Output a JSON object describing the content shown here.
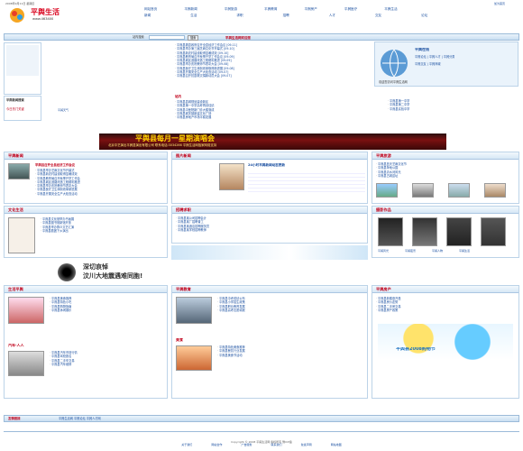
{
  "top": {
    "date": "2008年9月11日 星期四",
    "right_link": "加为首页"
  },
  "logo": {
    "main": "平舆生活",
    "sub": "www.463400"
  },
  "nav": [
    [
      "网站首页",
      "平舆新闻",
      "平舆旅游",
      "平舆教育",
      "平舆房产",
      "平舆医疗",
      "平舆生活"
    ],
    [
      "新闻",
      "生活",
      "求职",
      "招聘",
      "人才",
      "交友",
      "论坛"
    ]
  ],
  "search": {
    "label": "站内搜索",
    "button": "搜索"
  },
  "weather": {
    "title": "平舆天气",
    "text": "今天 晴 28℃/17℃"
  },
  "left_sidebar": {
    "title": "平舆新闻搜索",
    "sub": "今日热门关键"
  },
  "center_top_title": "平舆生活网欢迎您",
  "center_top_items": [
    "平舆县委县政府召开全县经济工作会议 [09-11]",
    "平舆县举办第三届芝麻文化节开幕式 [09-10]",
    "平舆县新农村建设取得显著成效 [09-10]",
    "平舆县教育局召开秋季开学工作会议 [09-09]",
    "平舆县城区道路改造工程顺利推进 [09-09]",
    "平舆县举办庆祝教师节表彰大会 [09-08]",
    "平舆县医疗卫生体制改革取得新进展 [09-08]",
    "平舆县开展安全生产大检查活动 [09-07]",
    "平舆县召开抗震救灾捐款动员大会 [09-07]"
  ],
  "center_second": {
    "title": "站内",
    "items": [
      "平舆县县城规划建设新区",
      "平舆县第一中学高考再创佳绩",
      "平舆县中医院新门诊大楼落成",
      "平舆县城关镇新建文化广场",
      "平舆县房地产市场平稳发展"
    ]
  },
  "right_box": {
    "title": "平舆在线",
    "items": [
      "平舆论坛",
      "平舆人才",
      "平舆分类",
      "平舆交友",
      "平舆商城"
    ],
    "text": "欢迎您访问平舆生活网"
  },
  "right_list": [
    "平舆县第一中学",
    "平舆县第二中学",
    "平舆县实验中学"
  ],
  "concert": {
    "title": "平舆县每月一星期演唱会",
    "sub": "北京中艺演出平舆县演出有限公司 联系电话:3034266 平舆生活网独家网络支持"
  },
  "sec_news": {
    "title": "平舆新闻",
    "more": "更多>>",
    "headline": "平舆县召开全县经济工作会议",
    "items": [
      "平舆县举办芝麻文化节开幕式",
      "平舆县新农村建设取得显著成效",
      "平舆县教育局召开秋季开学工作会",
      "平舆县城区道路改造工程顺利推进",
      "平舆县举办庆祝教师节表彰大会",
      "平舆县医疗卫生体制改革新进展",
      "平舆县开展安全生产大检查活动"
    ]
  },
  "sec_gallery": {
    "title": "图片新闻",
    "caption": "24小时平舆新闻动态更新"
  },
  "sec_travel": {
    "title": "平舆旅游",
    "items": [
      "平舆县蓝天芝麻文化节",
      "平舆县挚地公园",
      "平舆县清水河风光",
      "平舆县古城遗址"
    ]
  },
  "sec_culture": {
    "title": "文化生活",
    "items": [
      "平舆县文化馆举办书画展",
      "平舆县图书馆新馆开放",
      "平舆县举办群众文艺汇演",
      "平舆县剧团下乡演出"
    ]
  },
  "sec_jobs": {
    "title": "招聘求职",
    "items": [
      "平舆县某公司招聘会计",
      "平舆县某厂招聘普工",
      "平舆县某酒店招聘服务员",
      "平舆县某学校招聘教师"
    ]
  },
  "sec_photos": {
    "title": "摄影作品",
    "labels": [
      "平舆风光",
      "平舆夜景",
      "平舆人物",
      "平舆生活"
    ]
  },
  "earthquake": {
    "line1": "深切哀悼",
    "line2": "汶川大地震遇难同胞!"
  },
  "left_column": {
    "title1": "生活平舆",
    "items1": [
      "平舆县美食推荐",
      "平舆县特色小吃",
      "平舆县购物指南",
      "平舆县休闲娱乐"
    ],
    "title2": "汽车·人人",
    "items2": [
      "平舆县汽车市场行情",
      "平舆县驾校报名",
      "平舆县二手车交易",
      "平舆县汽车维修"
    ]
  },
  "mid_column": {
    "title": "平舆教育",
    "items": [
      "平舆县中考成绩公布",
      "平舆县小学招生政策",
      "平舆县职业教育发展",
      "平舆县高考志愿填报"
    ],
    "title2": "美食",
    "items2": [
      "平舆县特色美食推荐",
      "平舆县餐饮行业发展",
      "平舆县美食节活动"
    ]
  },
  "right_column": {
    "title": "平舆房产",
    "items": [
      "平舆县新楼盘开盘",
      "平舆县房价走势",
      "平舆县二手房交易",
      "平舆县房产政策"
    ],
    "promo": "平舆县2008购物节"
  },
  "footer_bar": {
    "label": "友情链接",
    "text": "平舆生活网 平舆论坛 平舆人才网"
  },
  "footer_links": [
    "关于我们",
    "网站合作",
    "广告服务",
    "联系我们",
    "免责声明",
    "网站地图"
  ],
  "footer_copy": "Copyright © 2008 平舆生活网 版权所有 豫ICP备"
}
